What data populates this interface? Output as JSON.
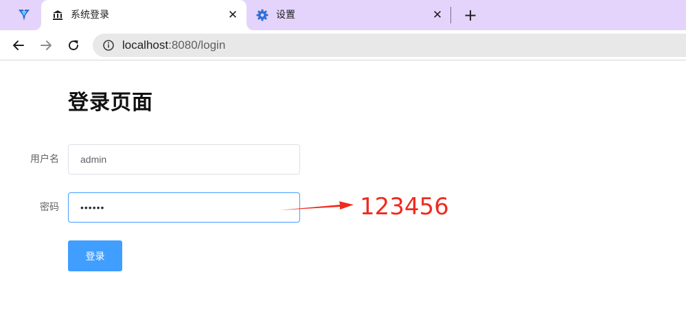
{
  "browser": {
    "tabs": [
      {
        "title": "系统登录",
        "favicon": "bank-icon",
        "active": true
      },
      {
        "title": "设置",
        "favicon": "gear-icon",
        "active": false
      }
    ],
    "new_tab_icon": "plus-icon",
    "close_icon": "close-icon",
    "nav": {
      "back_icon": "arrow-left-icon",
      "forward_icon": "arrow-right-icon",
      "reload_icon": "reload-icon"
    },
    "url": {
      "host": "localhost",
      "rest": ":8080/login"
    },
    "colors": {
      "tabstrip": "#e4d4fb",
      "omnibox": "#e8e8e8"
    }
  },
  "page": {
    "title": "登录页面",
    "form": {
      "username_label": "用户名",
      "username_value": "admin",
      "password_label": "密码",
      "password_mask": "••••••",
      "submit_label": "登录"
    },
    "annotation": {
      "text": "123456",
      "color": "#ef2a1f"
    },
    "colors": {
      "primary": "#409eff",
      "input_border": "#dcdfe6",
      "label": "#606266"
    }
  }
}
